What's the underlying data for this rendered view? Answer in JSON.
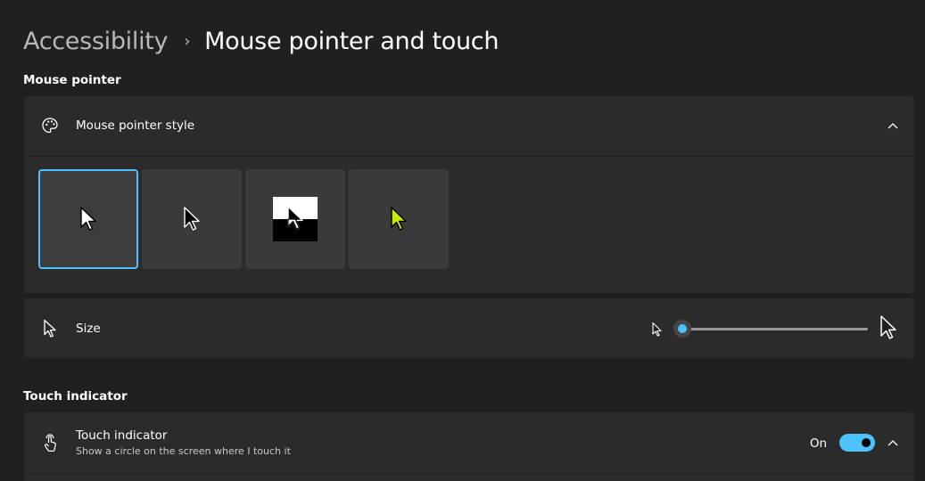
{
  "breadcrumb": {
    "parent": "Accessibility",
    "separator": "›",
    "current": "Mouse pointer and touch"
  },
  "mouse_pointer_section": {
    "title": "Mouse pointer",
    "style_card": {
      "label": "Mouse pointer style",
      "icon": "palette-icon",
      "expanded": true,
      "options": [
        {
          "name": "white",
          "selected": true
        },
        {
          "name": "black",
          "selected": false
        },
        {
          "name": "inverted",
          "selected": false
        },
        {
          "name": "custom",
          "selected": false,
          "color": "#c6e80f"
        }
      ]
    },
    "size_card": {
      "label": "Size",
      "icon": "cursor-icon",
      "slider_value_fraction": 0.0
    }
  },
  "touch_section": {
    "title": "Touch indicator",
    "card": {
      "label": "Touch indicator",
      "description": "Show a circle on the screen where I touch it",
      "toggle_label": "On",
      "toggle_on": true,
      "icon": "touch-icon"
    }
  },
  "colors": {
    "accent": "#4cc2ff",
    "background": "#202020",
    "card": "#2b2b2b"
  }
}
